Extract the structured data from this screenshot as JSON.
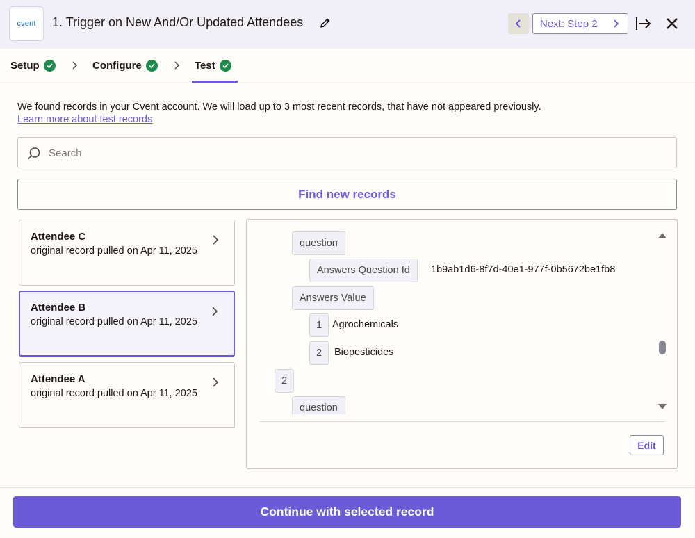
{
  "header": {
    "logo_text": "cvent",
    "title": "1. Trigger on New And/Or Updated Attendees",
    "next_label": "Next: Step 2"
  },
  "tabs": [
    {
      "label": "Setup",
      "complete": true
    },
    {
      "label": "Configure",
      "complete": true
    },
    {
      "label": "Test",
      "complete": true,
      "active": true
    }
  ],
  "info": {
    "text": "We found records in your Cvent account. We will load up to 3 most recent records, that have not appeared previously.",
    "link": "Learn more about test records"
  },
  "search": {
    "placeholder": "Search"
  },
  "find_button": "Find new records",
  "records": [
    {
      "name": "Attendee C",
      "subtitle": "original record pulled on Apr 11, 2025",
      "selected": false
    },
    {
      "name": "Attendee B",
      "subtitle": "original record pulled on Apr 11, 2025",
      "selected": true
    },
    {
      "name": "Attendee A",
      "subtitle": "original record pulled on Apr 11, 2025",
      "selected": false
    }
  ],
  "detail": {
    "question_1": "question",
    "answers_question_id_label": "Answers Question Id",
    "answers_question_id_value": "1b9ab1d6-8f7d-40e1-977f-0b5672be1fb8",
    "answers_value_label": "Answers Value",
    "item_1_index": "1",
    "item_1_value": "Agrochemicals",
    "item_2_index": "2",
    "item_2_value": "Biopesticides",
    "group_2_index": "2",
    "question_2": "question",
    "edit_label": "Edit"
  },
  "footer": {
    "continue_label": "Continue with selected record"
  },
  "colors": {
    "accent": "#6b5bd6",
    "success": "#1e8a4c",
    "header_bg": "#f1f0f8"
  }
}
